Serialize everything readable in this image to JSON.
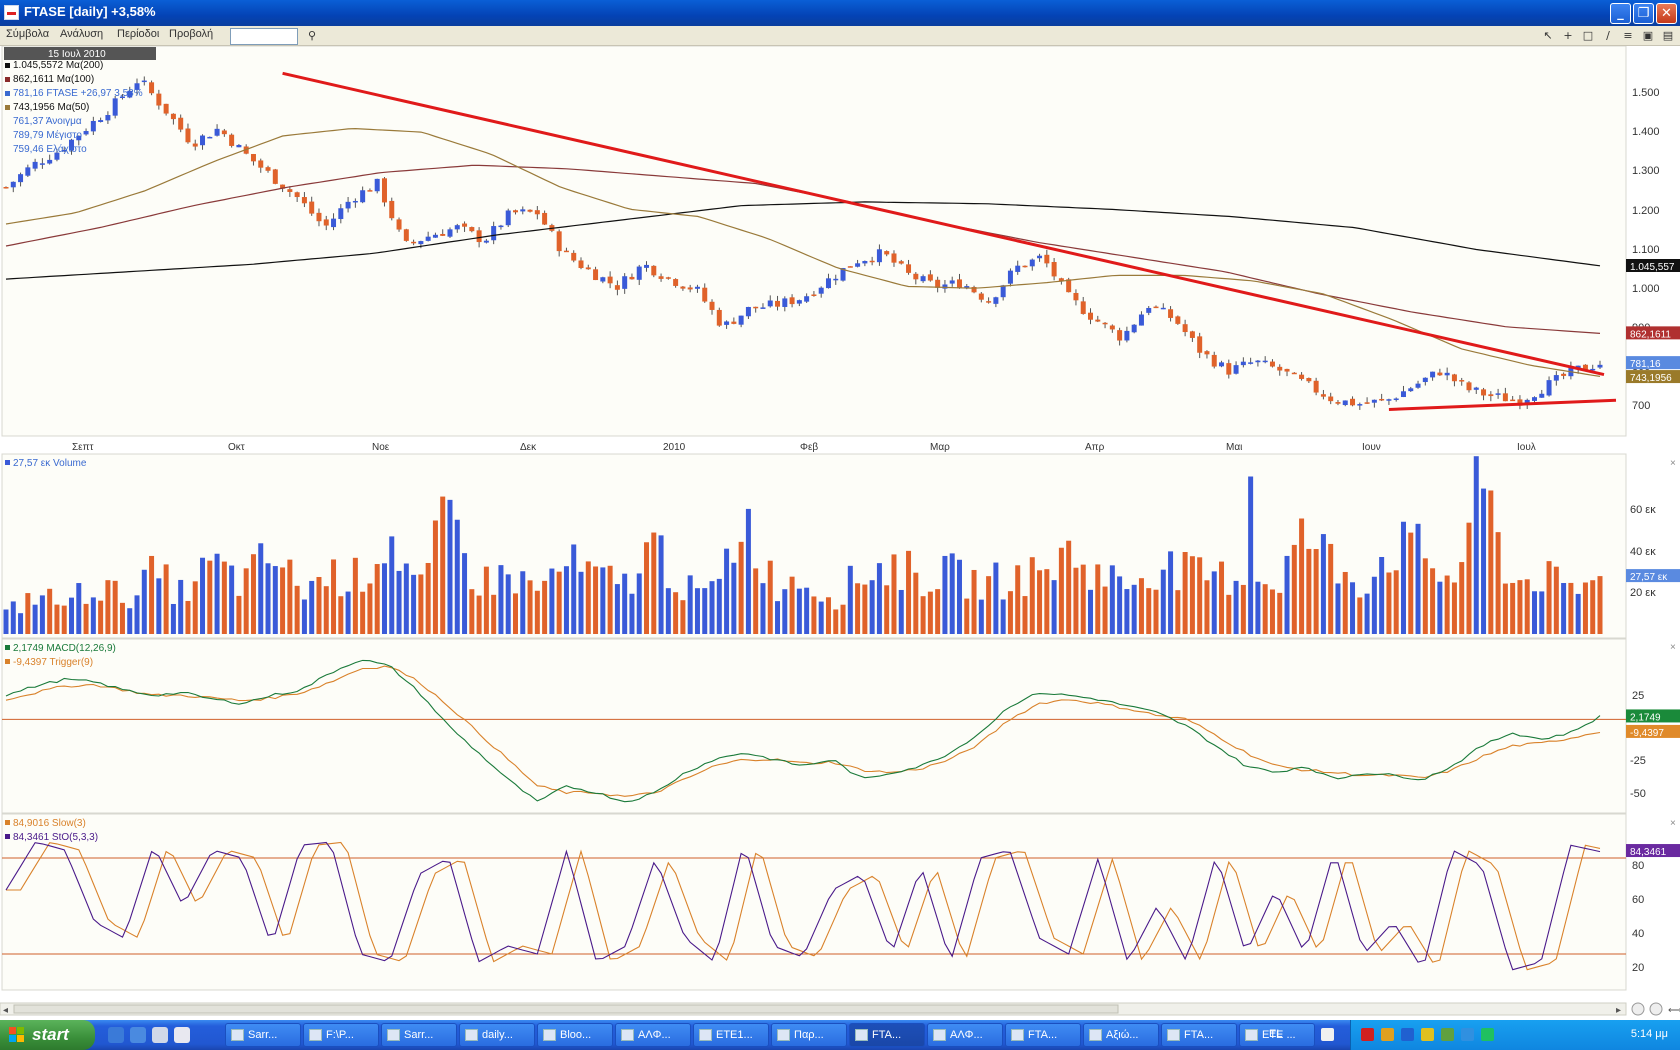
{
  "window": {
    "title": "FTASE [daily] +3,58%",
    "min_glyph": "_",
    "max_glyph": "❐",
    "close_glyph": "✕"
  },
  "menu": {
    "items": [
      "Σύμβολα",
      "Ανάλυση",
      "Περίοδοι",
      "Προβολή"
    ],
    "symbol_value": ""
  },
  "toolbar": {
    "icons": [
      "pointer-icon",
      "crosshair-icon",
      "rectangle-icon",
      "trendline-icon",
      "fibonacci-icon",
      "layout-icon",
      "save-icon"
    ]
  },
  "chart_data": [
    {
      "type": "candlestick",
      "title": "",
      "date_badge": "15 Ιουλ 2010",
      "x_tick_labels": [
        "Σεπτ",
        "Οκτ",
        "Νοε",
        "Δεκ",
        "2010",
        "Φεβ",
        "Μαρ",
        "Απρ",
        "Μαι",
        "Ιουν",
        "Ιουλ"
      ],
      "y_tick_labels": [
        "1.500",
        "1.400",
        "1.300",
        "1.200",
        "1.100",
        "1.000",
        "900",
        "800",
        "700"
      ],
      "ylim": [
        610,
        1590
      ],
      "legend": [
        {
          "text": "1.045,5572 Mα(200)",
          "color": "#111111"
        },
        {
          "text": "862,1611 Mα(100)",
          "color": "#8a2a2a"
        },
        {
          "text": "781,16 FTASE +26,97 3,58%",
          "color": "#3a6ad0"
        },
        {
          "text": "743,1956 Mα(50)",
          "color": "#9a7a3a"
        },
        {
          "text": "761,37 Άνοιγμα",
          "color": "#3a6ad0"
        },
        {
          "text": "789,79 Μέγιστο",
          "color": "#3a6ad0"
        },
        {
          "text": "759,46 Ελάχιστο",
          "color": "#3a6ad0"
        }
      ],
      "right_badges": [
        {
          "text": "1.045,557",
          "value": 1045.557,
          "bg": "#111111"
        },
        {
          "text": "862,1611",
          "value": 862.16,
          "bg": "#b03030"
        },
        {
          "text": "781,16",
          "value": 781.16,
          "bg": "#5a8ae0"
        },
        {
          "text": "743,1956",
          "value": 743.2,
          "bg": "#9a7a2a"
        }
      ],
      "close_anchors": [
        1260,
        1320,
        1360,
        1420,
        1480,
        1555,
        1470,
        1380,
        1420,
        1350,
        1290,
        1230,
        1150,
        1230,
        1270,
        1100,
        1130,
        1150,
        1115,
        1190,
        1190,
        1080,
        1030,
        990,
        1050,
        1010,
        980,
        880,
        930,
        940,
        960,
        1010,
        1060,
        1080,
        1020,
        990,
        1000,
        950,
        1040,
        1070,
        960,
        900,
        850,
        940,
        900,
        810,
        760,
        785,
        760,
        720,
        680,
        670,
        680,
        720,
        760,
        710,
        690,
        680,
        720,
        760,
        781
      ],
      "ma50_anchors": [
        1160,
        1190,
        1250,
        1330,
        1400,
        1420,
        1410,
        1350,
        1260,
        1200,
        1180,
        1120,
        1040,
        990,
        985,
        1000,
        1020,
        1020,
        1005,
        970,
        900,
        820,
        775,
        745
      ],
      "ma100_anchors": [
        1100,
        1150,
        1210,
        1260,
        1300,
        1320,
        1310,
        1290,
        1270,
        1220,
        1160,
        1110,
        1070,
        1030,
        970,
        920,
        880,
        862
      ],
      "ma200_anchors": [
        1010,
        1030,
        1050,
        1080,
        1130,
        1170,
        1210,
        1220,
        1215,
        1200,
        1180,
        1150,
        1090,
        1046
      ],
      "trendline_down": {
        "from": {
          "date": "20 Οκτ 2009",
          "value": 1570
        },
        "to": {
          "date": "20 Ιουλ 2010",
          "value": 750
        }
      },
      "trendline_up": {
        "from": {
          "date": "7 Ιουν 2010",
          "value": 655
        },
        "to": {
          "date": "20 Ιουλ 2010",
          "value": 680
        }
      }
    },
    {
      "type": "bar",
      "title": "27,57 εκ Volume",
      "y_tick_labels": [
        "60 εκ",
        "40 εκ",
        "20 εκ"
      ],
      "ylim": [
        0,
        80
      ],
      "last_badge": "27,57 εκ",
      "volume_anchors": [
        10,
        20,
        15,
        25,
        18,
        30,
        20,
        35,
        25,
        40,
        22,
        30,
        28,
        50,
        20,
        60,
        25,
        30,
        22,
        35,
        28,
        25,
        45,
        22,
        20,
        60,
        25,
        28,
        18,
        30,
        35,
        28,
        30,
        25,
        28,
        30,
        40,
        30,
        25,
        35,
        30,
        28,
        30,
        25,
        50,
        35,
        25,
        45,
        40,
        25,
        75,
        25,
        30,
        20,
        28
      ],
      "spike_index": 1253,
      "last_value": 27.57
    },
    {
      "type": "line",
      "title": "MACD",
      "series_legend": [
        {
          "text": "2,1749 MACD(12,26,9)",
          "color": "#1a7a3a"
        },
        {
          "text": "-9,4397 Trigger(9)",
          "color": "#d9822b"
        }
      ],
      "y_tick_labels": [
        "25",
        "-25",
        "-50"
      ],
      "ylim": [
        -65,
        55
      ],
      "zero_line": 0,
      "badges": [
        {
          "text": "2,1749",
          "value": 2.17,
          "bg": "#1a8a3a"
        },
        {
          "text": "-9,4397",
          "value": -9.44,
          "bg": "#e08a2a"
        }
      ],
      "macd_anchors": [
        18,
        25,
        30,
        28,
        22,
        18,
        20,
        15,
        12,
        18,
        22,
        35,
        45,
        40,
        20,
        -5,
        -25,
        -45,
        -62,
        -50,
        -55,
        -62,
        -55,
        -40,
        -30,
        -25,
        -30,
        -35,
        -30,
        -45,
        -40,
        -35,
        -25,
        -10,
        10,
        20,
        18,
        15,
        10,
        5,
        -5,
        -20,
        -35,
        -40,
        -35,
        -45,
        -40,
        -42,
        -45,
        -35,
        -20,
        -10,
        -15,
        -10,
        2
      ],
      "trigger_anchors": [
        15,
        20,
        25,
        26,
        22,
        18,
        18,
        16,
        14,
        16,
        20,
        28,
        38,
        40,
        28,
        10,
        -10,
        -30,
        -50,
        -55,
        -55,
        -58,
        -55,
        -45,
        -35,
        -30,
        -30,
        -33,
        -32,
        -38,
        -40,
        -37,
        -30,
        -18,
        0,
        12,
        15,
        12,
        8,
        3,
        0,
        -12,
        -25,
        -35,
        -38,
        -40,
        -42,
        -42,
        -44,
        -38,
        -28,
        -20,
        -18,
        -14,
        -9
      ]
    },
    {
      "type": "line",
      "title": "Stochastic",
      "series_legend": [
        {
          "text": "84,9016 Slow(3)",
          "color": "#d9822b"
        },
        {
          "text": "84,3461 StO(5,3,3)",
          "color": "#4a1a8a"
        }
      ],
      "y_tick_labels": [
        "80",
        "60",
        "40",
        "20"
      ],
      "ylim": [
        0,
        100
      ],
      "hlines": [
        80,
        20
      ],
      "badge": {
        "text": "84,3461",
        "value": 84.35,
        "bg": "#6a2aa0"
      },
      "sto_anchors": [
        60,
        90,
        85,
        40,
        30,
        88,
        50,
        85,
        80,
        25,
        88,
        90,
        20,
        15,
        70,
        80,
        15,
        25,
        20,
        85,
        15,
        25,
        80,
        30,
        15,
        90,
        25,
        18,
        60,
        70,
        20,
        75,
        15,
        80,
        85,
        30,
        20,
        80,
        15,
        50,
        15,
        82,
        20,
        60,
        20,
        85,
        20,
        40,
        10,
        85,
        75,
        10,
        15,
        88,
        84
      ]
    }
  ],
  "scrollbar": {
    "left_glyph": "◂",
    "right_glyph": "▸"
  },
  "taskbar": {
    "start_label": "start",
    "tasks": [
      {
        "label": "Sarr...",
        "active": false
      },
      {
        "label": "F:\\P...",
        "active": false
      },
      {
        "label": "Sarr...",
        "active": false
      },
      {
        "label": "daily...",
        "active": false
      },
      {
        "label": "Bloo...",
        "active": false
      },
      {
        "label": "ΑΛΦ...",
        "active": false
      },
      {
        "label": "ETE1...",
        "active": false
      },
      {
        "label": "Παρ...",
        "active": false
      },
      {
        "label": "FTA...",
        "active": true
      },
      {
        "label": "ΑΛΦ...",
        "active": false
      },
      {
        "label": "FTA...",
        "active": false
      },
      {
        "label": "Αξιώ...",
        "active": false
      },
      {
        "label": "FTA...",
        "active": false
      },
      {
        "label": "ETE ...",
        "active": false
      }
    ],
    "language": "EL",
    "clock": "5:14 μμ"
  },
  "colors": {
    "bull": "#3a5ad8",
    "bear": "#e0622a",
    "trend": "#e01a1a",
    "ma200": "#111111",
    "ma100": "#8a3a3a",
    "ma50": "#9a7a3a",
    "macd": "#1a7a3a",
    "trigger": "#d9822b",
    "sto": "#4a1a8a",
    "slow": "#d9822b"
  }
}
